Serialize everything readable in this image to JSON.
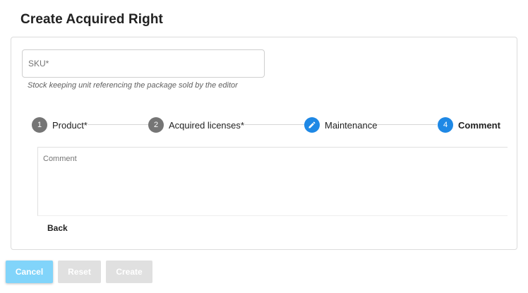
{
  "page": {
    "title": "Create Acquired Right"
  },
  "sku": {
    "label": "SKU*",
    "hint": "Stock keeping unit referencing the package sold by the editor"
  },
  "stepper": {
    "steps": [
      {
        "number": "1",
        "label": "Product*",
        "state": "done",
        "color": "#757575"
      },
      {
        "number": "2",
        "label": "Acquired licenses*",
        "state": "done",
        "color": "#757575"
      },
      {
        "number": "",
        "label": "Maintenance",
        "state": "edited",
        "icon": "pencil-icon",
        "color": "#1e88e5"
      },
      {
        "number": "4",
        "label": "Comment",
        "state": "active",
        "color": "#1e88e5"
      }
    ]
  },
  "comment": {
    "label": "Comment"
  },
  "navigation": {
    "back_label": "Back"
  },
  "actions": {
    "cancel_label": "Cancel",
    "reset_label": "Reset",
    "create_label": "Create"
  },
  "colors": {
    "accent": "#1e88e5",
    "cancel_button": "#81d4fa",
    "disabled_button": "#e0e0e0"
  }
}
